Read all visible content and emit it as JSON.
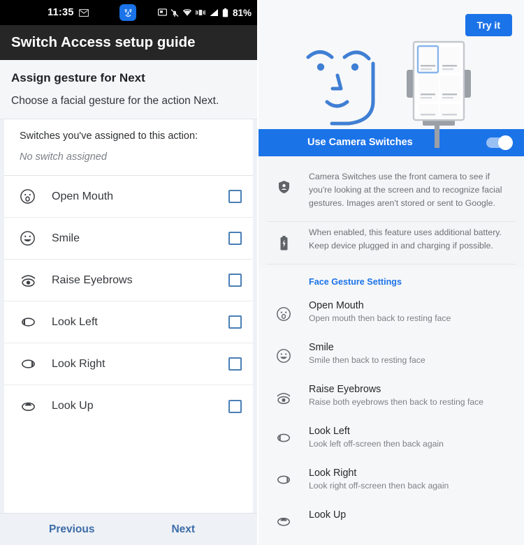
{
  "left": {
    "statusbar": {
      "time": "11:35",
      "battery_percent": "81%",
      "icons": [
        "message-icon",
        "face-switch-icon",
        "screenshot-icon",
        "notifications-muted-icon",
        "wifi-icon",
        "vibrate-icon",
        "signal-icon",
        "battery-icon"
      ]
    },
    "appbar_title": "Switch Access setup guide",
    "intro": {
      "title": "Assign gesture for Next",
      "subtitle": "Choose a facial gesture for the action Next."
    },
    "assigned": {
      "label": "Switches you've assigned to this action:",
      "value": "No switch assigned"
    },
    "gestures": [
      {
        "label": "Open Mouth",
        "icon": "open-mouth-icon",
        "checked": false
      },
      {
        "label": "Smile",
        "icon": "smile-icon",
        "checked": false
      },
      {
        "label": "Raise Eyebrows",
        "icon": "raise-eyebrows-icon",
        "checked": false
      },
      {
        "label": "Look Left",
        "icon": "look-left-icon",
        "checked": false
      },
      {
        "label": "Look Right",
        "icon": "look-right-icon",
        "checked": false
      },
      {
        "label": "Look Up",
        "icon": "look-up-icon",
        "checked": false
      }
    ],
    "nav": {
      "previous": "Previous",
      "next": "Next"
    }
  },
  "right": {
    "try_button": "Try it",
    "camera_switches": {
      "label": "Use Camera Switches",
      "enabled": true
    },
    "info": [
      {
        "icon": "privacy-shield-icon",
        "text": "Camera Switches use the front camera to see if you're looking at the screen and to recognize facial gestures. Images aren't stored or sent to Google."
      },
      {
        "icon": "battery-charging-icon",
        "text": "When enabled, this feature uses additional battery. Keep device plugged in and charging if possible."
      }
    ],
    "settings_header": "Face Gesture Settings",
    "settings": [
      {
        "title": "Open Mouth",
        "desc": "Open mouth then back to resting face",
        "icon": "open-mouth-icon"
      },
      {
        "title": "Smile",
        "desc": "Smile then back to resting face",
        "icon": "smile-icon"
      },
      {
        "title": "Raise Eyebrows",
        "desc": "Raise both eyebrows then back to resting face",
        "icon": "raise-eyebrows-icon"
      },
      {
        "title": "Look Left",
        "desc": "Look left off-screen then back again",
        "icon": "look-left-icon"
      },
      {
        "title": "Look Right",
        "desc": "Look right off-screen then back again",
        "icon": "look-right-icon"
      },
      {
        "title": "Look Up",
        "desc": "",
        "icon": "look-up-icon"
      }
    ]
  },
  "colors": {
    "accent_blue": "#1b73e8",
    "statusbar_black": "#000000",
    "appbar_dark": "#262626",
    "checkbox_blue": "#4a7fb5",
    "link_blue": "#3c6ca8"
  }
}
